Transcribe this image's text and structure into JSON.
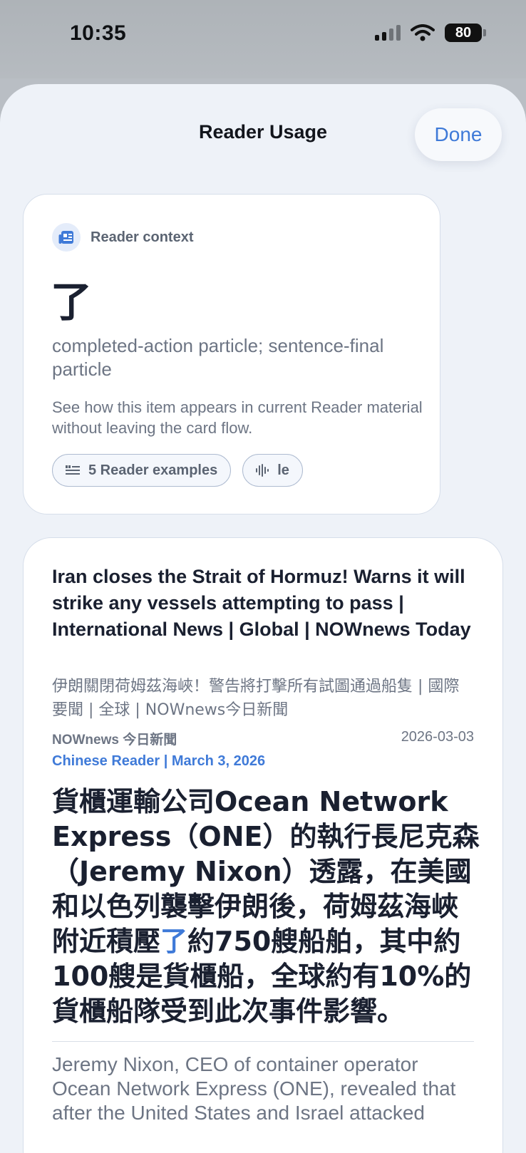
{
  "status_bar": {
    "time": "10:35",
    "battery": "80"
  },
  "sheet": {
    "title": "Reader Usage",
    "done_label": "Done"
  },
  "context_card": {
    "label": "Reader context",
    "character": "了",
    "gloss": "completed-action particle; sentence-final particle",
    "description": "See how this item appears in current Reader material without leaving the card flow.",
    "chips": [
      {
        "icon": "quote-list-icon",
        "label": "5 Reader examples"
      },
      {
        "icon": "waveform-icon",
        "label": "le"
      }
    ]
  },
  "article": {
    "title": "Iran closes the Strait of Hormuz! Warns it will strike any vessels attempting to pass | International News | Global | NOWnews Today",
    "title_zh": "伊朗關閉荷姆茲海峽！警告將打擊所有試圖通過船隻 | 國際要聞 | 全球 | NOWnews今日新聞",
    "source": "NOWnews 今日新聞",
    "date": "2026-03-03",
    "reader_label": "Chinese Reader | March 3, 2026",
    "body_before": "貨櫃運輸公司Ocean Network Express（ONE）的執行長尼克森（Jeremy Nixon）透露，在美國和以色列襲擊伊朗後，荷姆茲海峽附近積壓",
    "body_highlight": "了",
    "body_after": "約750艘船舶，其中約100艘是貨櫃船，全球約有10%的貨櫃船隊受到此次事件影響。",
    "translation": "Jeremy Nixon, CEO of container operator Ocean Network Express (ONE), revealed that after the United States and Israel attacked"
  },
  "colors": {
    "accent": "#3f7ad8",
    "sheet_bg": "#eef2f8",
    "text_dark": "#1a2030",
    "text_muted": "#6d7584"
  }
}
